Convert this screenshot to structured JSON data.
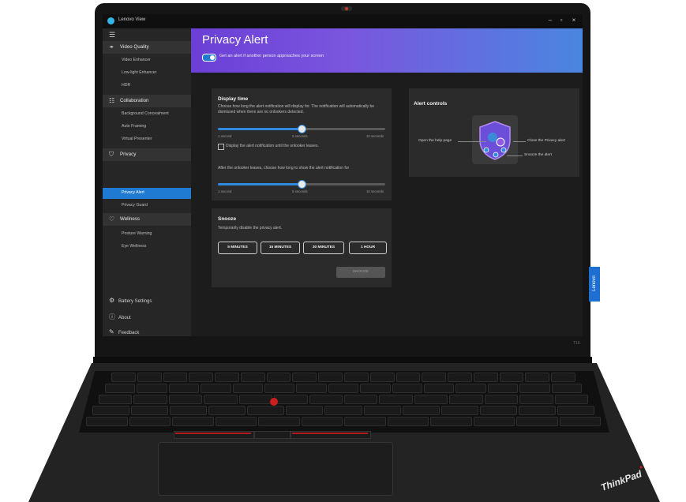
{
  "window": {
    "title": "Lenovo View"
  },
  "sidebar": {
    "sections": [
      {
        "label": "Video Quality",
        "icon": "video-quality-icon",
        "items": [
          "Video Enhancer",
          "Low-light Enhancer",
          "HDR"
        ]
      },
      {
        "label": "Collaboration",
        "icon": "collaboration-icon",
        "items": [
          "Background Concealment",
          "Auto Framing",
          "Virtual Presenter"
        ]
      },
      {
        "label": "Privacy",
        "icon": "privacy-icon",
        "items": [
          "Privacy Alert",
          "Privacy Guard"
        ]
      },
      {
        "label": "Wellness",
        "icon": "wellness-icon",
        "items": [
          "Posture Warning",
          "Eye Wellness"
        ]
      }
    ],
    "active_item": "Privacy Alert",
    "footer": [
      {
        "label": "Battery Settings",
        "icon": "battery-settings-icon"
      },
      {
        "label": "About",
        "icon": "about-icon"
      },
      {
        "label": "Feedback",
        "icon": "feedback-icon"
      }
    ]
  },
  "header": {
    "title": "Privacy Alert",
    "toggle_label": "Get an alert if another person approaches your screen",
    "toggle_on": true
  },
  "display_time": {
    "title": "Display time",
    "description": "Choose how long the alert notification will display for. The notification will automatically be dismissed when there are no onlookers detected.",
    "slider1": {
      "ticks": [
        "1 second",
        "5 seconds",
        "10 seconds"
      ],
      "value_fraction": 0.5
    },
    "checkbox_label": "Display the alert notification until the onlooker leaves.",
    "checkbox_checked": false,
    "after_text": "After the onlooker leaves, choose how long to show the alert notification for",
    "slider2": {
      "ticks": [
        "1 second",
        "5 seconds",
        "10 seconds"
      ],
      "value_fraction": 0.5
    }
  },
  "snooze": {
    "title": "Snooze",
    "description": "Temporarily disable the privacy alert.",
    "options": [
      "5 MINUTES",
      "15 MINUTES",
      "30 MINUTES",
      "1 HOUR"
    ],
    "action": "SNOOZE"
  },
  "alert_controls": {
    "title": "Alert controls",
    "annotations": {
      "help": "Open the help page",
      "close": "Close the Privacy alert",
      "snooze": "Snooze the alert"
    }
  },
  "device": {
    "brand_tag": "Lenovo",
    "model": "T16",
    "logo": "ThinkPad"
  },
  "colors": {
    "accent": "#1f7bd1",
    "header_start": "#6b3fd6",
    "header_end": "#4a86e0",
    "trackpoint": "#c81e1e"
  }
}
